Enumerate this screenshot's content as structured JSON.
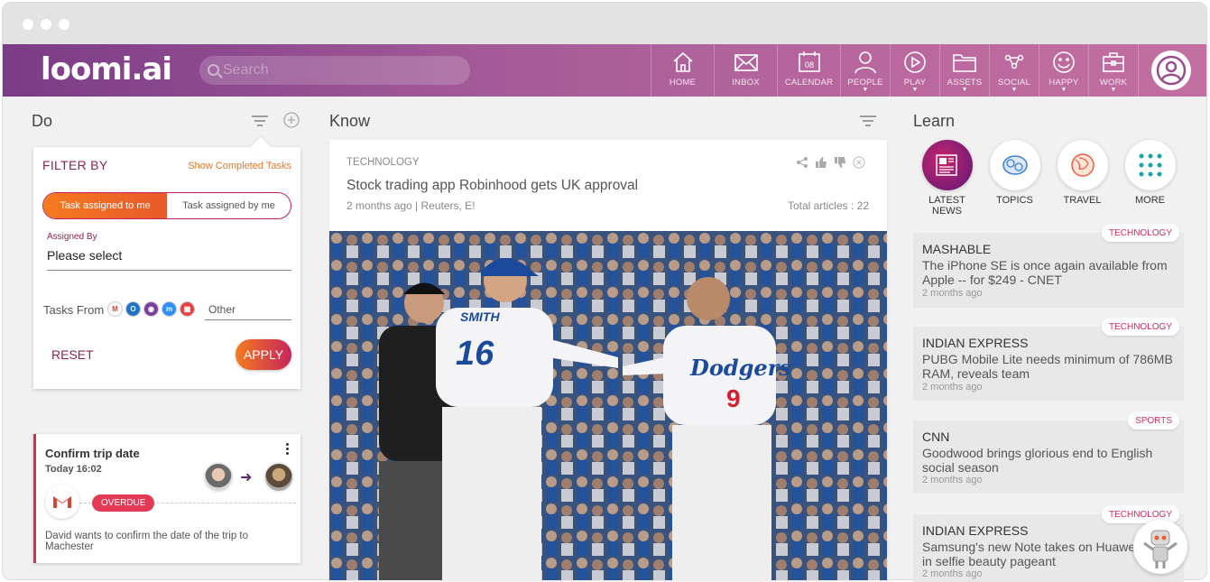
{
  "app": {
    "logo": "loomi.ai"
  },
  "search": {
    "placeholder": "Search"
  },
  "nav": {
    "home": "HOME",
    "inbox": "INBOX",
    "calendar": "CALENDAR",
    "calendar_day": "08",
    "people": "PEOPLE",
    "play": "PLAY",
    "assets": "ASSETS",
    "social": "SOCIAL",
    "happy": "HAPPY",
    "work": "WORK"
  },
  "do": {
    "title": "Do",
    "filter": {
      "title": "FILTER BY",
      "show_completed": "Show Completed Tasks",
      "toggle_left": "Task assigned to me",
      "toggle_right": "Task assigned by me",
      "assigned_by_label": "Assigned By",
      "assigned_by_value": "Please select",
      "tasks_from_label": "Tasks From",
      "other_placeholder": "Other",
      "reset": "RESET",
      "apply": "APPLY"
    },
    "task": {
      "title": "Confirm trip date",
      "time": "Today 16:02",
      "status": "OVERDUE",
      "description": "David wants to confirm the date of the trip to Machester"
    }
  },
  "know": {
    "title": "Know",
    "article": {
      "category": "TECHNOLOGY",
      "headline": "Stock trading app Robinhood gets UK approval",
      "meta": "2 months ago | Reuters, E!",
      "total": "Total articles : 22",
      "jersey_name": "SMITH",
      "jersey_number_1": "16",
      "jersey_team": "Dodgers",
      "jersey_number_2": "9"
    }
  },
  "learn": {
    "title": "Learn",
    "circles": [
      {
        "label": "LATEST NEWS"
      },
      {
        "label": "TOPICS"
      },
      {
        "label": "TRAVEL"
      },
      {
        "label": "MORE"
      }
    ],
    "news": [
      {
        "tag": "TECHNOLOGY",
        "source": "MASHABLE",
        "text": "The iPhone SE is once again available from Apple -- for $249 - CNET",
        "ago": "2 months ago"
      },
      {
        "tag": "TECHNOLOGY",
        "source": "INDIAN EXPRESS",
        "text": "PUBG Mobile Lite needs minimum of 786MB RAM, reveals team",
        "ago": "2 months ago"
      },
      {
        "tag": "SPORTS",
        "source": "CNN",
        "text": "Goodwood brings glorious end to English social season",
        "ago": "2 months ago"
      },
      {
        "tag": "TECHNOLOGY",
        "source": "INDIAN EXPRESS",
        "text": "Samsung's new Note takes on Huawei in selfie beauty pageant",
        "ago": "2 months ago"
      }
    ]
  },
  "colors": {
    "brand_start": "#7b3c86",
    "brand_end": "#c26ea1",
    "accent_orange": "#f47b20",
    "accent_red": "#e23a55"
  }
}
